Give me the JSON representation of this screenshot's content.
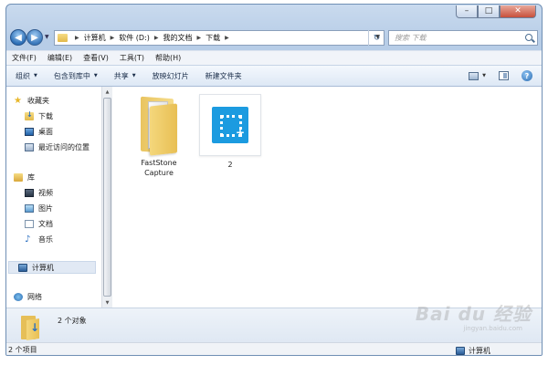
{
  "address": {
    "crumbs": [
      "计算机",
      "软件 (D:)",
      "我的文档",
      "下载"
    ]
  },
  "search": {
    "placeholder": "搜索 下载"
  },
  "menubar": {
    "items": [
      "文件(F)",
      "编辑(E)",
      "查看(V)",
      "工具(T)",
      "帮助(H)"
    ]
  },
  "toolbar": {
    "organize": "组织",
    "include_in_library": "包含到库中",
    "share": "共享",
    "slideshow": "放映幻灯片",
    "new_folder": "新建文件夹"
  },
  "navpane": {
    "favorites": "收藏夹",
    "favorites_items": [
      "下载",
      "桌面",
      "最近访问的位置"
    ],
    "libraries": "库",
    "library_items": [
      "视频",
      "图片",
      "文档",
      "音乐"
    ],
    "computer": "计算机",
    "network": "网络"
  },
  "files": [
    {
      "label_line1": "FastStone",
      "label_line2": "Capture",
      "type": "folder"
    },
    {
      "label_line1": "2",
      "label_line2": "",
      "type": "app"
    }
  ],
  "details": {
    "count_text": "2 个对象"
  },
  "statusbar": {
    "left": "2 个项目",
    "right": "计算机"
  },
  "watermark": {
    "text": "Bai du 经验",
    "sub": "jingyan.baidu.com"
  }
}
